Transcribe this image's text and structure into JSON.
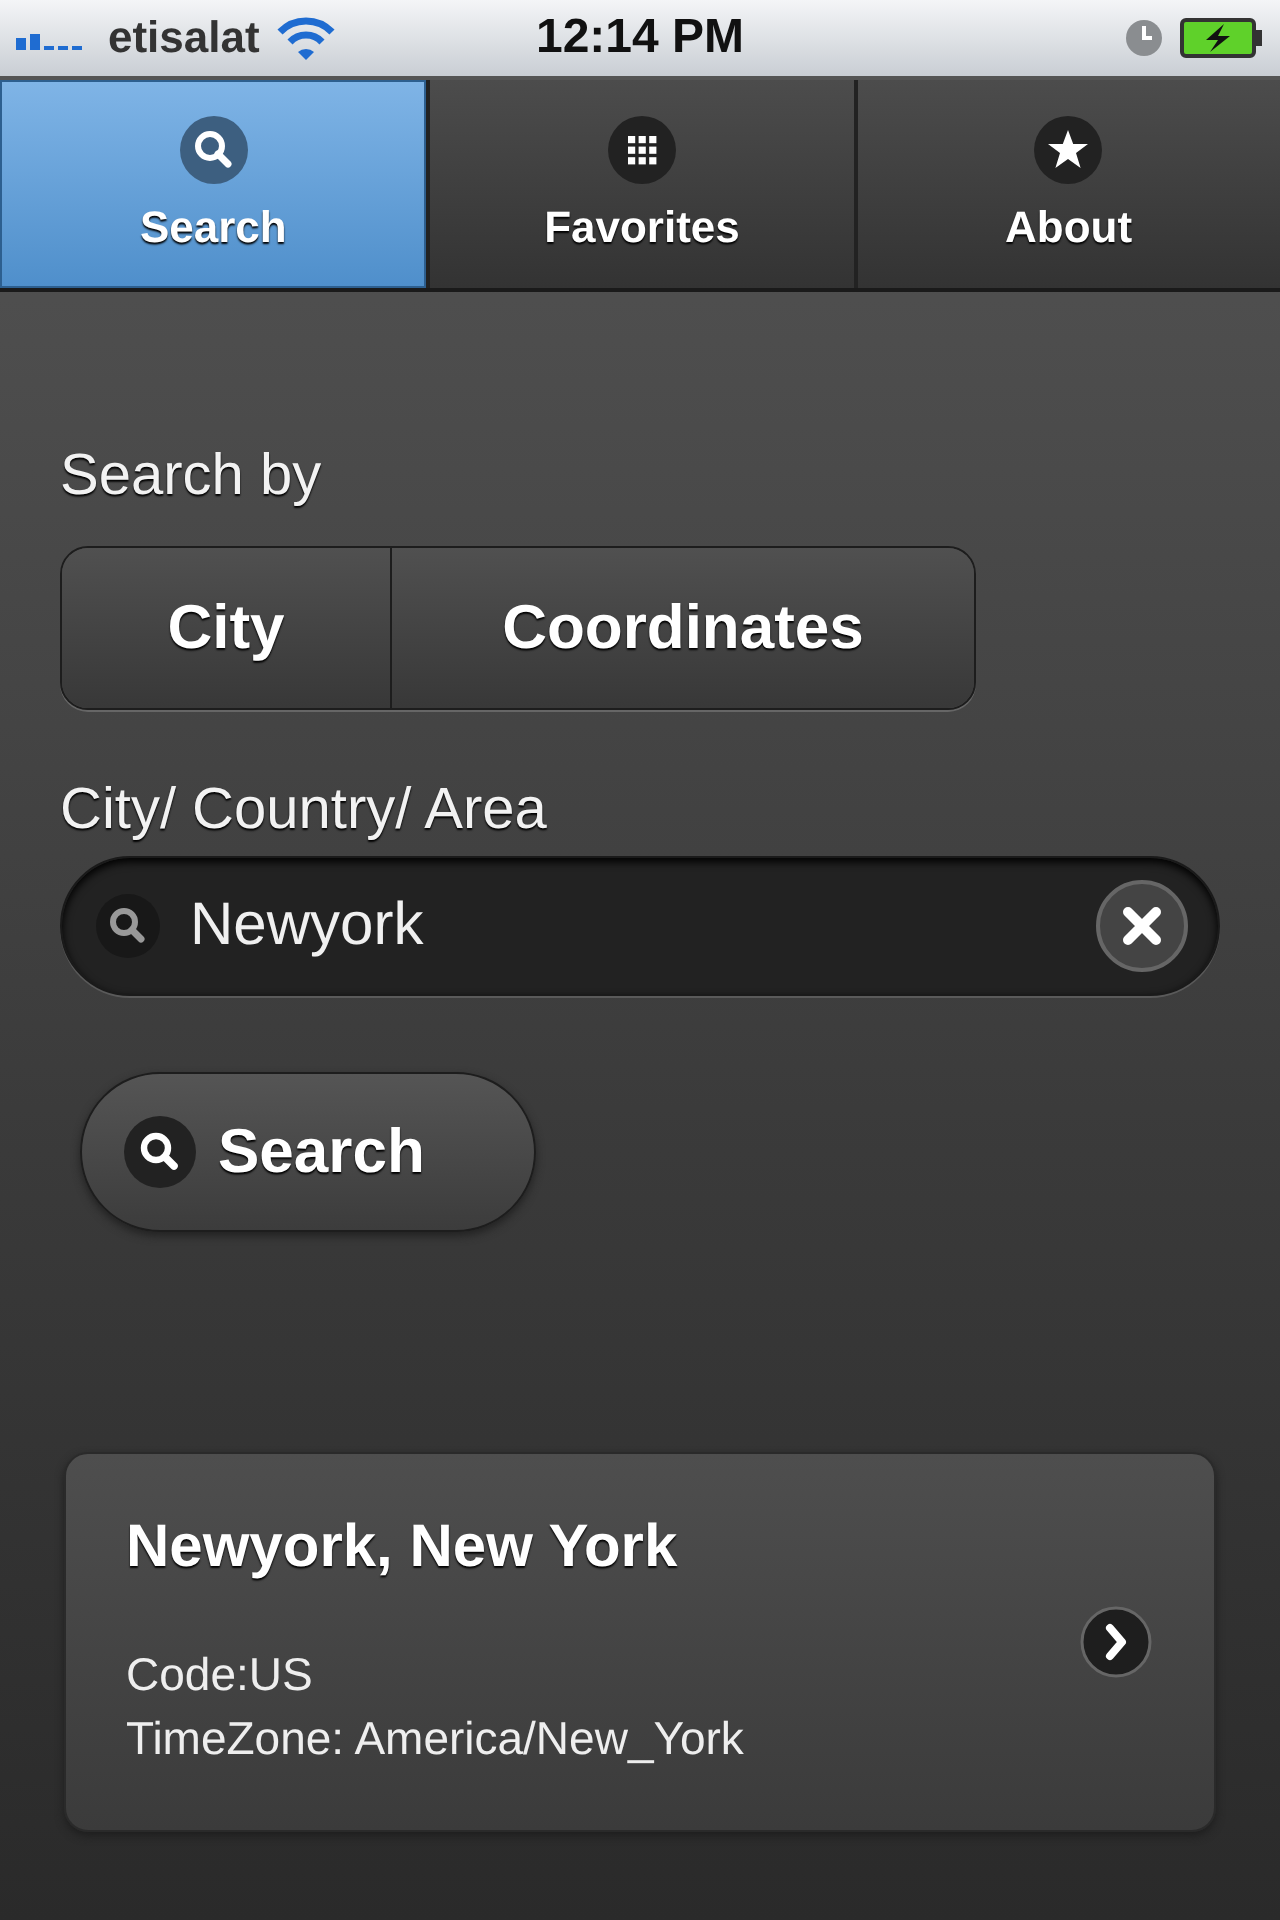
{
  "status_bar": {
    "carrier": "etisalat",
    "time": "12:14 PM"
  },
  "tabs": [
    {
      "label": "Search",
      "kind": "search",
      "selected": true
    },
    {
      "label": "Favorites",
      "kind": "grid",
      "selected": false
    },
    {
      "label": "About",
      "kind": "star",
      "selected": false
    }
  ],
  "search_by": {
    "label": "Search by",
    "options": [
      {
        "label": "City",
        "selected": false
      },
      {
        "label": "Coordinates",
        "selected": false
      }
    ]
  },
  "field": {
    "label": "City/ Country/ Area",
    "value": "Newyork"
  },
  "search_button": {
    "label": "Search"
  },
  "results": [
    {
      "title": "Newyork, New York",
      "code": "Code:US",
      "timezone": "TimeZone: America/New_York"
    }
  ]
}
